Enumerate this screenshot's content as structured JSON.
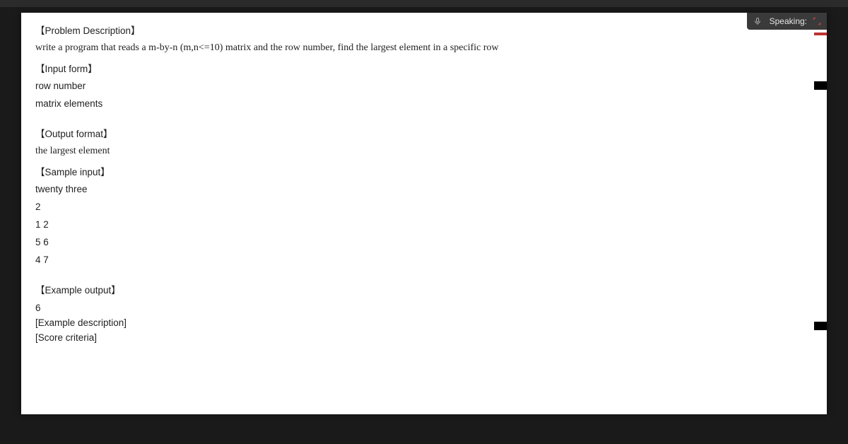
{
  "overlay": {
    "speaking_label": "Speaking:"
  },
  "doc": {
    "h_problem": "【Problem Description】",
    "problem_text": "write a program that reads a m-by-n (m,n<=10) matrix and the row number, find the largest element in a specific row",
    "h_input": "【Input form】",
    "input_line1": "row number",
    "input_line2": "matrix elements",
    "h_output": "【Output format】",
    "output_text": "the largest element",
    "h_sample_input": "【Sample input】",
    "sample_input_lines": [
      "twenty three",
      "2",
      "1 2",
      "5 6",
      "4 7"
    ],
    "h_example_output": "【Example output】",
    "example_output_value": "6",
    "h_example_desc": "[Example description]",
    "h_score": "[Score criteria]"
  }
}
